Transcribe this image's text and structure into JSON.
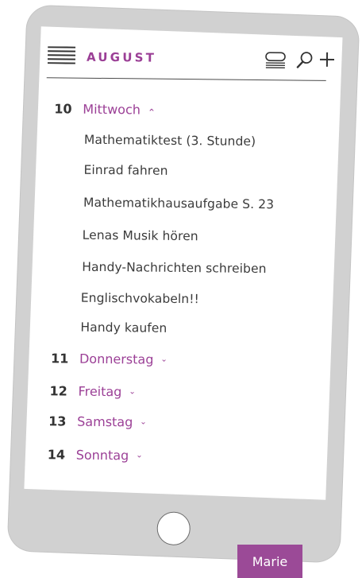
{
  "header": {
    "month": "AUGUST",
    "icons": {
      "menu": "hamburger-menu-icon",
      "list": "list-view-icon",
      "search": "search-icon",
      "add": "plus-icon"
    }
  },
  "days": [
    {
      "number": "10",
      "name": "Mittwoch",
      "expanded": true,
      "chevron": "⌃",
      "events": [
        "Mathematiktest (3. Stunde)",
        "Einrad fahren",
        "Mathematikhausaufgabe S. 23",
        "Lenas Musik hören",
        "Handy-Nachrichten schreiben",
        "Englischvokabeln!!",
        "Handy kaufen"
      ]
    },
    {
      "number": "11",
      "name": "Donnerstag",
      "expanded": false,
      "chevron": "⌄"
    },
    {
      "number": "12",
      "name": "Freitag",
      "expanded": false,
      "chevron": "⌄"
    },
    {
      "number": "13",
      "name": "Samstag",
      "expanded": false,
      "chevron": "⌄"
    },
    {
      "number": "14",
      "name": "Sonntag",
      "expanded": false,
      "chevron": "⌄"
    }
  ],
  "owner_tag": "Marie",
  "colors": {
    "accent": "#9b3f96",
    "tag": "#9b4a97",
    "phone": "#d1d1d1",
    "text": "#3a3a3a"
  }
}
